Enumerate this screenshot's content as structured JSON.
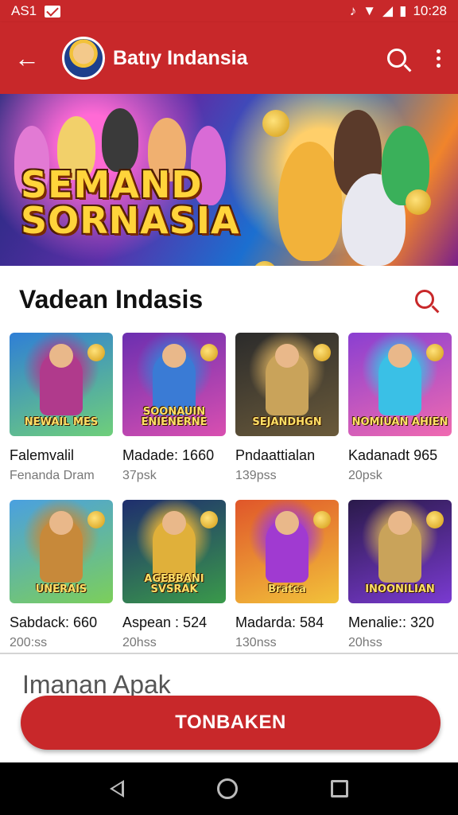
{
  "status_bar": {
    "carrier": "AS1",
    "time": "10:28"
  },
  "app_bar": {
    "title": "Batıy Indansia",
    "icons": [
      "back-arrow-icon",
      "avatar",
      "search-icon",
      "more-vert-icon"
    ]
  },
  "banner": {
    "title_line1": "SEMAND",
    "title_line2": "SORNASIA"
  },
  "section": {
    "title": "Vadean Indasis"
  },
  "games": [
    {
      "thumb_text": "NEWAIL MES",
      "title": "Falemvalil",
      "subtitle": "Fenanda Dram",
      "theme": [
        "#2f7fd6",
        "#6fcf7a",
        "#b03a8c"
      ]
    },
    {
      "thumb_text": "SOONAUIN ENIENERNE",
      "title": "Madade: 1660",
      "subtitle": "37psk",
      "theme": [
        "#6b2fb0",
        "#d94fb0",
        "#3a7bd5"
      ]
    },
    {
      "thumb_text": "SEJANDHGN",
      "title": "Pndaattialan",
      "subtitle": "139pss",
      "theme": [
        "#2b2b2b",
        "#6a5a3a",
        "#c9a35a"
      ]
    },
    {
      "thumb_text": "NOMIUAN AHIEN",
      "title": "Kadanadt 965",
      "subtitle": "20psk",
      "theme": [
        "#8a3fd1",
        "#f06ab0",
        "#3ac0e6"
      ]
    },
    {
      "thumb_text": "UNERAIS",
      "title": "Sabdack: 660",
      "subtitle": "200:ss",
      "theme": [
        "#4aa0e0",
        "#7ccf5a",
        "#c7893a"
      ]
    },
    {
      "thumb_text": "AGEBBANI SVSRAK",
      "title": "Aspean : 524",
      "subtitle": "20hss",
      "theme": [
        "#1f2e6e",
        "#3a9a4a",
        "#e0b03a"
      ]
    },
    {
      "thumb_text": "Bratca",
      "title": "Madarda: 584",
      "subtitle": "130nss",
      "theme": [
        "#e0562a",
        "#f2c23a",
        "#a03ad1"
      ]
    },
    {
      "thumb_text": "INOONILIAN",
      "title": "Menalie:: 320",
      "subtitle": "20hss",
      "theme": [
        "#2a1a4a",
        "#7a3ad1",
        "#c9a35a"
      ]
    }
  ],
  "section2": {
    "title": "Imanan Apak"
  },
  "cta": {
    "label": "TONBAKEN"
  },
  "nav": {
    "icons": [
      "nav-back-icon",
      "nav-home-icon",
      "nav-recents-icon"
    ]
  },
  "colors": {
    "primary": "#c8282a",
    "background": "#ffffff",
    "nav": "#000000"
  }
}
